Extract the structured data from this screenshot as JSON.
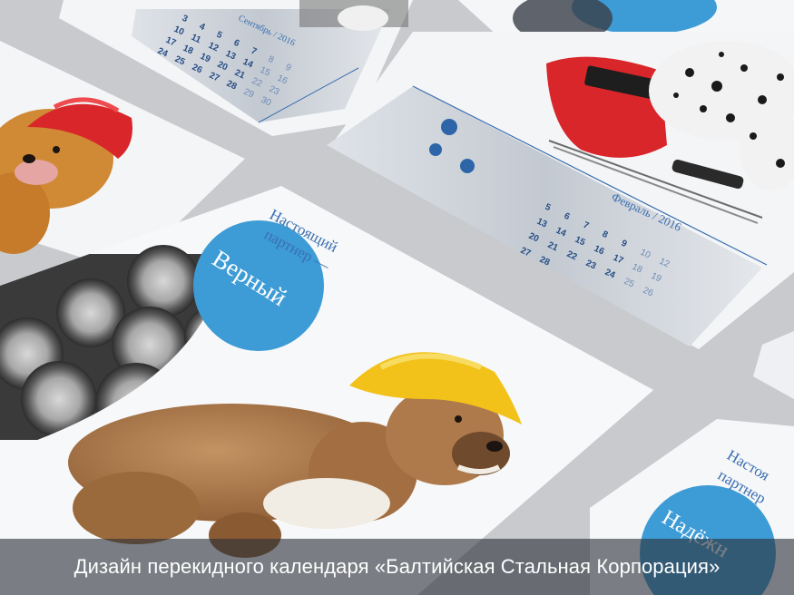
{
  "caption": "Дизайн перекидного календаря «Балтийская Стальная Корпорация»",
  "main_card": {
    "headline": [
      "Настоящий",
      "партнер —"
    ],
    "circle_word": "Верный"
  },
  "corner_card": {
    "headline": [
      "Настоя",
      "партнер"
    ],
    "circle_word": "Надёжн"
  },
  "calendar_top": {
    "month": "Сентябрь / 2016",
    "days": [
      "3",
      "4",
      "5",
      "6",
      "7",
      "8",
      "9",
      "10",
      "11",
      "12",
      "13",
      "14",
      "15",
      "16",
      "17",
      "18",
      "19",
      "20",
      "21",
      "22",
      "23",
      "24",
      "25",
      "26",
      "27",
      "28",
      "29",
      "30"
    ]
  },
  "calendar_right": {
    "month": "Февраль / 2016",
    "days": [
      "5",
      "6",
      "7",
      "8",
      "9",
      "10",
      "12",
      "13",
      "14",
      "15",
      "16",
      "17",
      "18",
      "19",
      "20",
      "21",
      "22",
      "23",
      "24",
      "25",
      "26",
      "27",
      "28"
    ]
  },
  "colors": {
    "accent_blue": "#3d9bd6",
    "text_blue": "#3a6fb0",
    "helmet_red": "#d8262a",
    "helmet_yellow": "#f2c21a",
    "caption_bar": "#2d323a"
  },
  "icons": [
    "golden-retriever-red-helmet",
    "bulldog-yellow-helmet",
    "dalmatian",
    "welding-mask",
    "steel-bars",
    "company-logo"
  ]
}
